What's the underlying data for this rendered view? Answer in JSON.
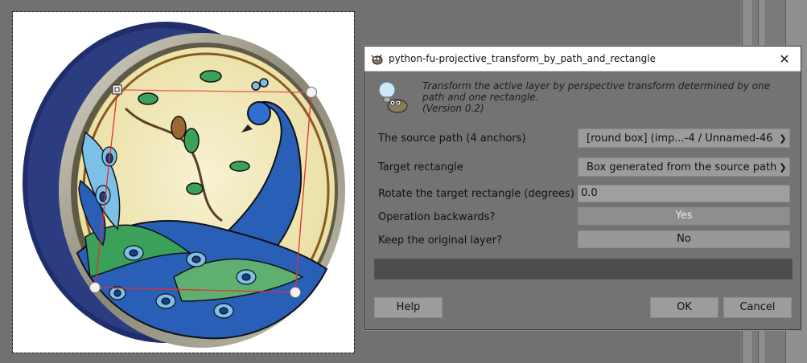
{
  "dialog": {
    "title": "python-fu-projective_transform_by_path_and_rectangle",
    "description": "Transform the active layer by perspective transform determined by one path and one rectangle.",
    "version": "(Version 0.2)",
    "fields": {
      "source_path_label": "The source path (4 anchors)",
      "source_path_value": "[round box] (imp...-4 / Unnamed-46",
      "target_rect_label": "Target rectangle",
      "target_rect_value": "Box generated from the source path",
      "rotate_label": "Rotate the target rectangle (degrees)",
      "rotate_value": "0.0",
      "backwards_label": "Operation backwards?",
      "backwards_value": "Yes",
      "keep_label": "Keep the original layer?",
      "keep_value": "No"
    },
    "buttons": {
      "help": "Help",
      "ok": "OK",
      "cancel": "Cancel"
    }
  },
  "colors": {
    "dialog_bg": "#737373",
    "titlebar_bg": "#ffffff",
    "path_red": "#e03030",
    "tin_blue": "#1f2e6b",
    "peacock_blue": "#2a5fb8",
    "leaf_green": "#3aa05a",
    "cream": "#f3ecc4"
  },
  "icons": [
    "gimp-wilber-icon",
    "close-icon",
    "lightbulb-icon",
    "chevron-down-icon"
  ]
}
